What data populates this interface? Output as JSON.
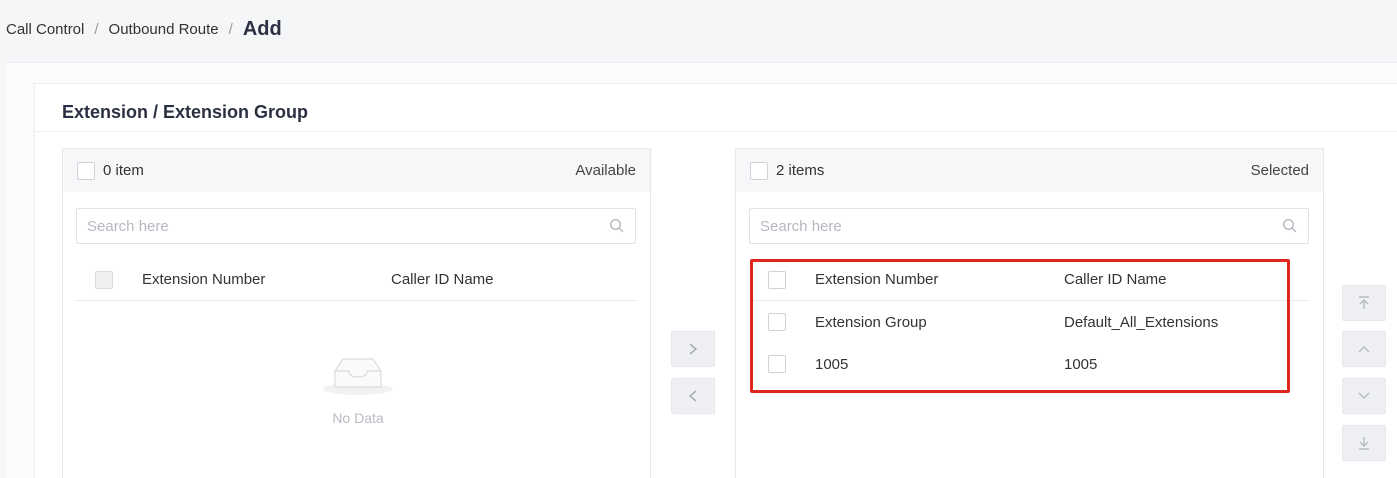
{
  "breadcrumb": {
    "items": [
      "Call Control",
      "Outbound Route"
    ],
    "separator": "/",
    "current": "Add"
  },
  "section": {
    "title": "Extension / Extension Group"
  },
  "available": {
    "count_label": "0 item",
    "status": "Available",
    "search_placeholder": "Search here",
    "columns": {
      "ext": "Extension Number",
      "cid": "Caller ID Name"
    },
    "empty_text": "No Data"
  },
  "selected": {
    "count_label": "2 items",
    "status": "Selected",
    "search_placeholder": "Search here",
    "columns": {
      "ext": "Extension Number",
      "cid": "Caller ID Name"
    },
    "rows": [
      {
        "ext": "Extension Group",
        "cid": "Default_All_Extensions"
      },
      {
        "ext": "1005",
        "cid": "1005"
      }
    ]
  },
  "transfer": {
    "add_icon": "chevron-right-icon",
    "remove_icon": "chevron-left-icon"
  },
  "order_buttons": [
    "move-top-icon",
    "move-up-icon",
    "move-down-icon",
    "move-bottom-icon"
  ],
  "colors": {
    "highlight": "#e0271f",
    "title": "#2b3142",
    "button_bg": "#eef0f3"
  }
}
